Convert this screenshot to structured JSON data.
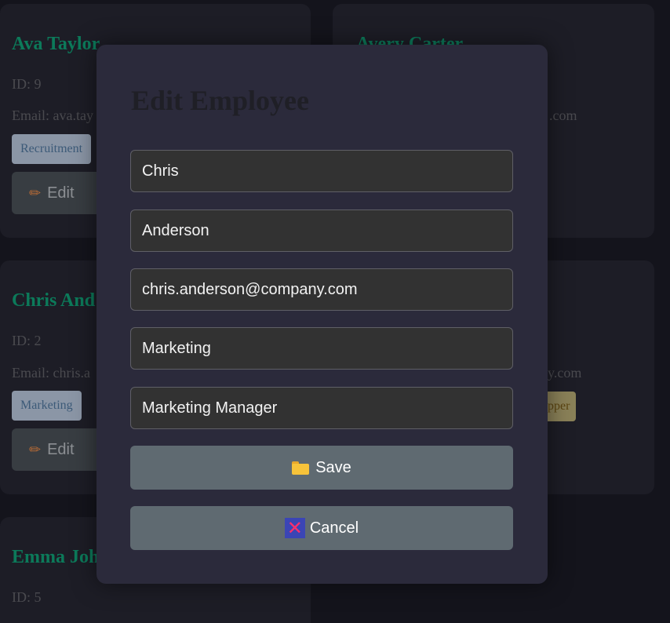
{
  "cards": [
    {
      "name": "Ava Taylor",
      "id_text": "ID: 9",
      "email_text": "Email: ava.tay",
      "department": "Recruitment",
      "edit_label": "Edit"
    },
    {
      "name": "Avery Carter",
      "email_tail": ".com"
    },
    {
      "name": "Chris And",
      "id_text": "ID: 2",
      "email_text": "Email: chris.a",
      "department": "Marketing",
      "edit_label": "Edit"
    },
    {
      "email_tail": "y.com",
      "role_tail": "pper"
    },
    {
      "name": "Emma Joh",
      "id_text": "ID: 5"
    }
  ],
  "modal": {
    "title": "Edit Employee",
    "fields": {
      "first_name": "Chris",
      "last_name": "Anderson",
      "email": "chris.anderson@company.com",
      "department": "Marketing",
      "position": "Marketing Manager"
    },
    "save_label": "Save",
    "cancel_label": "Cancel"
  },
  "icons": {
    "edit": "pencil-icon",
    "save": "folder-icon",
    "cancel": "cross-mark-icon"
  },
  "colors": {
    "page_bg": "#14141c",
    "card_bg": "#1d1d26",
    "modal_bg": "#2b2a3b",
    "name_accent": "#0c7a5a",
    "button_bg": "#5f6a71",
    "field_bg": "#323232"
  }
}
